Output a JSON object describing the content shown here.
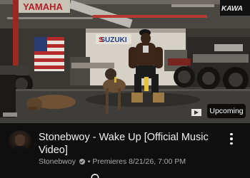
{
  "video": {
    "title": "Stonebwoy - Wake Up [Official Music Video]",
    "status_badge": "Upcoming",
    "scene_signs": {
      "left_sign": "YAMAHA",
      "center_sign": "SUZUKI",
      "right_sign": "KAWA"
    }
  },
  "channel": {
    "name": "Stonebwoy",
    "verified": true,
    "premiere_text": "Premieres 8/21/26, 7:00 PM",
    "separator": "•"
  },
  "icons": {
    "more": "more-vert-icon",
    "verified": "verified-check-icon",
    "reminder": "bell-icon"
  },
  "colors": {
    "background": "#0f0f0f",
    "primary_text": "#f1f1f1",
    "secondary_text": "#aaaaaa",
    "badge_bg": "#000000"
  }
}
